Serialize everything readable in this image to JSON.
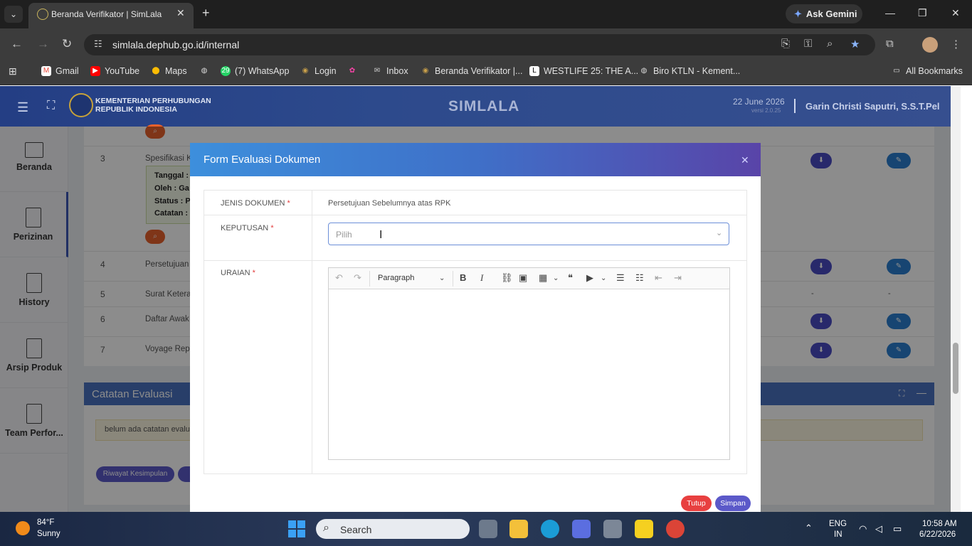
{
  "browser": {
    "tab_title": "Beranda Verifikator | SimLala",
    "gemini_label": "Ask Gemini",
    "url": "simlala.dephub.go.id/internal",
    "bookmarks": [
      "Gmail",
      "YouTube",
      "Maps",
      "",
      "(7) WhatsApp",
      "Login",
      "",
      "Inbox",
      "Beranda Verifikator |...",
      "WESTLIFE 25: THE A...",
      "Biro KTLN - Kement..."
    ],
    "whatsapp_badge": "29",
    "all_bookmarks": "All Bookmarks"
  },
  "header": {
    "ministry_line1": "KEMENTERIAN PERHUBUNGAN",
    "ministry_line2": "REPUBLIK INDONESIA",
    "app_name": "SIMLALA",
    "date": "22 June 2026",
    "version": "versi 2.0.25",
    "user": "Garin Christi Saputri, S.S.T.Pel"
  },
  "sidebar": {
    "items": [
      {
        "label": "Beranda"
      },
      {
        "label": "Perizinan"
      },
      {
        "label": "History"
      },
      {
        "label": "Arsip Produk"
      },
      {
        "label": "Team Perfor..."
      }
    ]
  },
  "background_table": {
    "rows": [
      {
        "no": "3",
        "name": "Spesifikasi Ka"
      },
      {
        "no": "4",
        "name": "Persetujuan S"
      },
      {
        "no": "5",
        "name": "Surat Keteran"
      },
      {
        "no": "6",
        "name": "Daftar Awak"
      },
      {
        "no": "7",
        "name": "Voyage Repo"
      }
    ],
    "info_labels": [
      "Tanggal :",
      "Oleh : Ga",
      "Status : P",
      "Catatan :"
    ],
    "dash": "-"
  },
  "evaluasi": {
    "title": "Catatan Evaluasi",
    "note": "belum ada catatan evalu",
    "riwayat_button": "Riwayat Kesimpulan"
  },
  "modal": {
    "title": "Form Evaluasi Dokumen",
    "jenis_label": "JENIS DOKUMEN",
    "jenis_value": "Persetujuan Sebelumnya atas RPK",
    "keputusan_label": "KEPUTUSAN",
    "keputusan_placeholder": "Pilih",
    "uraian_label": "URAIAN",
    "required_mark": "*",
    "editor_style": "Paragraph",
    "tutup": "Tutup",
    "simpan": "Simpan"
  },
  "taskbar": {
    "temp": "84°F",
    "weather": "Sunny",
    "search": "Search",
    "lang1": "ENG",
    "lang2": "IN",
    "time": "10:58 AM",
    "date": "6/22/2026"
  }
}
